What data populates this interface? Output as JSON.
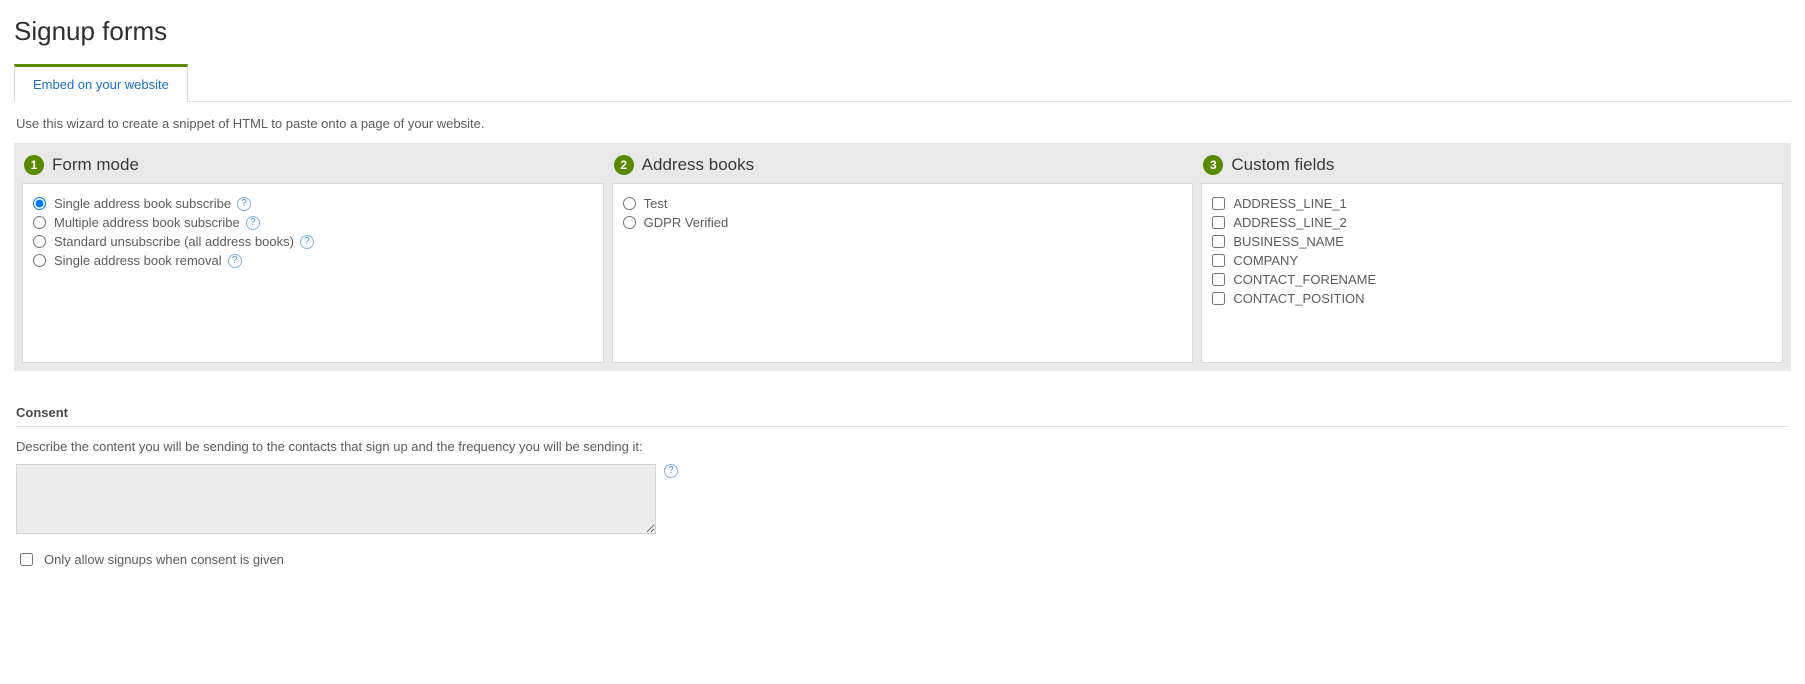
{
  "page": {
    "title": "Signup forms"
  },
  "tabs": {
    "embed": "Embed on your website"
  },
  "intro": "Use this wizard to create a snippet of HTML to paste onto a page of your website.",
  "wizard": {
    "step1": {
      "num": "1",
      "title": "Form mode",
      "options": [
        {
          "label": "Single address book subscribe",
          "help": true
        },
        {
          "label": "Multiple address book subscribe",
          "help": true
        },
        {
          "label": "Standard unsubscribe (all address books)",
          "help": true
        },
        {
          "label": "Single address book removal",
          "help": true
        }
      ]
    },
    "step2": {
      "num": "2",
      "title": "Address books",
      "options": [
        {
          "label": "Test"
        },
        {
          "label": "GDPR Verified"
        }
      ]
    },
    "step3": {
      "num": "3",
      "title": "Custom fields",
      "options": [
        {
          "label": "ADDRESS_LINE_1"
        },
        {
          "label": "ADDRESS_LINE_2"
        },
        {
          "label": "BUSINESS_NAME"
        },
        {
          "label": "COMPANY"
        },
        {
          "label": "CONTACT_FORENAME"
        },
        {
          "label": "CONTACT_POSITION"
        }
      ]
    }
  },
  "consent": {
    "heading": "Consent",
    "describe": "Describe the content you will be sending to the contacts that sign up and the frequency you will be sending it:",
    "textarea_value": "",
    "only_allow": "Only allow signups when consent is given"
  },
  "glyphs": {
    "help": "?"
  }
}
